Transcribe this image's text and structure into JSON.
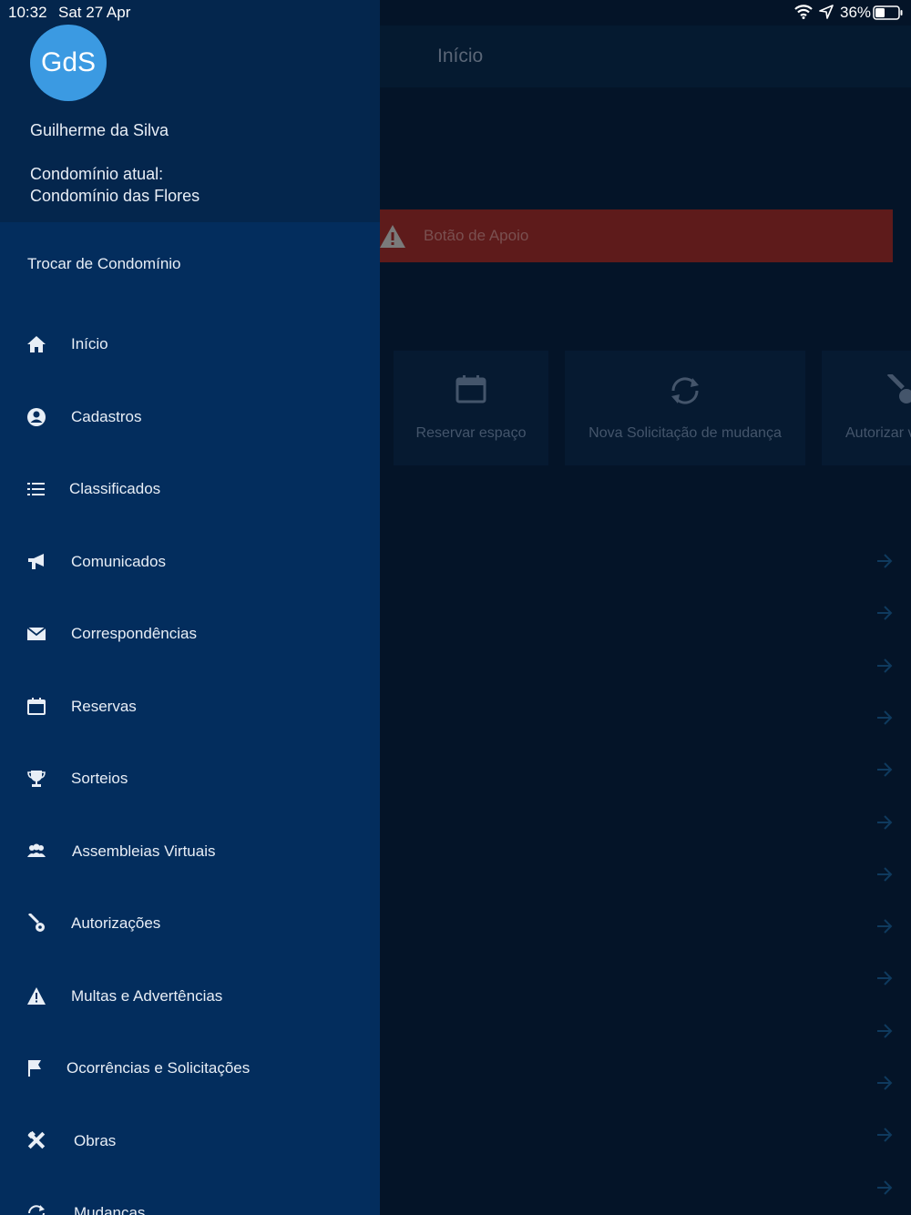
{
  "status_bar": {
    "time": "10:32",
    "date": "Sat 27 Apr",
    "battery": "36%"
  },
  "drawer": {
    "avatar_initials": "GdS",
    "user_name": "Guilherme da Silva",
    "condo_label": "Condomínio atual:",
    "condo_name": "Condomínio das Flores",
    "switch_label": "Trocar de Condomínio",
    "items": [
      {
        "label": "Início",
        "icon": "home-icon"
      },
      {
        "label": "Cadastros",
        "icon": "user-circle-icon"
      },
      {
        "label": "Classificados",
        "icon": "list-icon"
      },
      {
        "label": "Comunicados",
        "icon": "megaphone-icon"
      },
      {
        "label": "Correspondências",
        "icon": "envelope-icon"
      },
      {
        "label": "Reservas",
        "icon": "calendar-icon"
      },
      {
        "label": "Sorteios",
        "icon": "trophy-icon"
      },
      {
        "label": "Assembleias Virtuais",
        "icon": "group-icon"
      },
      {
        "label": "Autorizações",
        "icon": "key-icon"
      },
      {
        "label": "Multas e Advertências",
        "icon": "warning-icon"
      },
      {
        "label": "Ocorrências e Solicitações",
        "icon": "flag-icon"
      },
      {
        "label": "Obras",
        "icon": "tools-icon"
      },
      {
        "label": "Mudanças",
        "icon": "refresh-icon"
      }
    ]
  },
  "main": {
    "title": "Início",
    "support_button": "Botão de Apoio",
    "quick_actions": [
      {
        "label": "Reservar espaço",
        "icon": "calendar-icon"
      },
      {
        "label": "Nova Solicitação de mudança",
        "icon": "refresh-icon"
      },
      {
        "label": "Autorizar v",
        "icon": "key-icon"
      }
    ]
  },
  "colors": {
    "drawer_bg": "#032d5d",
    "drawer_header": "#04264d",
    "avatar": "#3b9ae2",
    "support_red": "#5e1b1b"
  }
}
